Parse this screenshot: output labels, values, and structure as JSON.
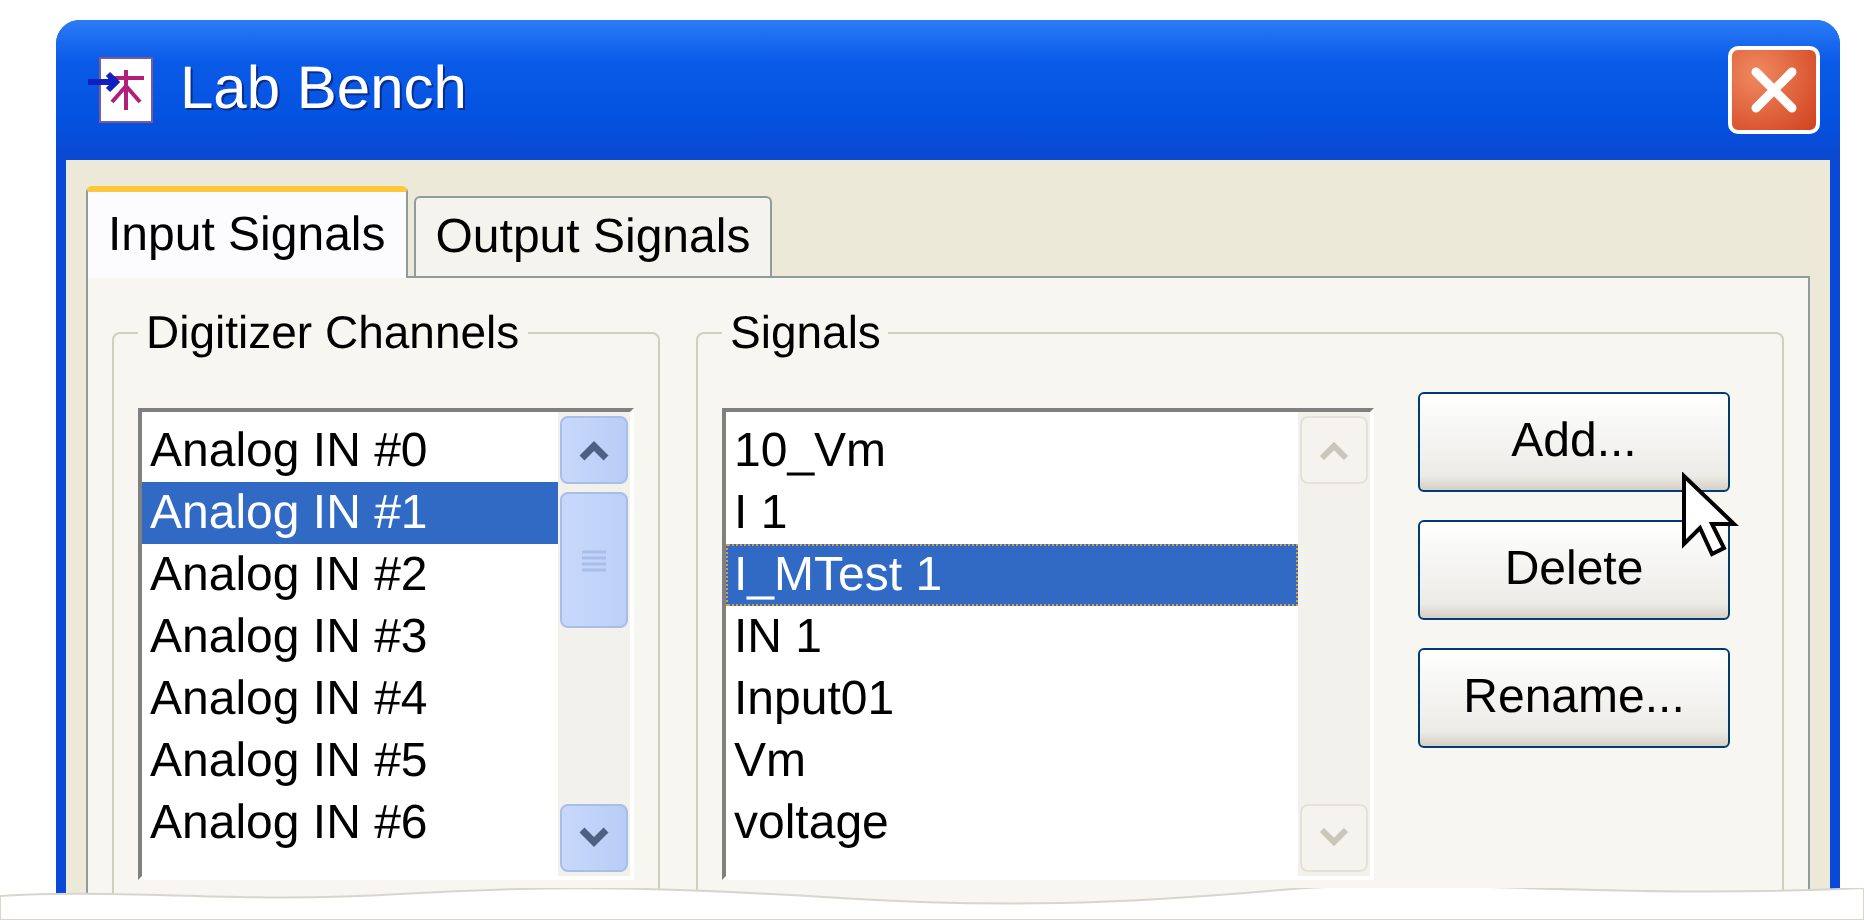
{
  "window": {
    "title": "Lab Bench"
  },
  "tabs": [
    {
      "label": "Input Signals",
      "selected": true
    },
    {
      "label": "Output Signals",
      "selected": false
    }
  ],
  "channels": {
    "label": "Digitizer Channels",
    "items": [
      {
        "label": "Analog IN #0",
        "selected": false
      },
      {
        "label": "Analog IN #1",
        "selected": true
      },
      {
        "label": "Analog IN #2",
        "selected": false
      },
      {
        "label": "Analog IN #3",
        "selected": false
      },
      {
        "label": "Analog IN #4",
        "selected": false
      },
      {
        "label": "Analog IN #5",
        "selected": false
      },
      {
        "label": "Analog IN #6",
        "selected": false
      }
    ]
  },
  "signals": {
    "label": "Signals",
    "items": [
      {
        "label": "10_Vm",
        "selected": false
      },
      {
        "label": "I 1",
        "selected": false
      },
      {
        "label": "I_MTest 1",
        "selected": true
      },
      {
        "label": "IN 1",
        "selected": false
      },
      {
        "label": "Input01",
        "selected": false
      },
      {
        "label": "Vm",
        "selected": false
      },
      {
        "label": "voltage",
        "selected": false
      }
    ],
    "buttons": [
      "Add...",
      "Delete",
      "Rename..."
    ]
  }
}
